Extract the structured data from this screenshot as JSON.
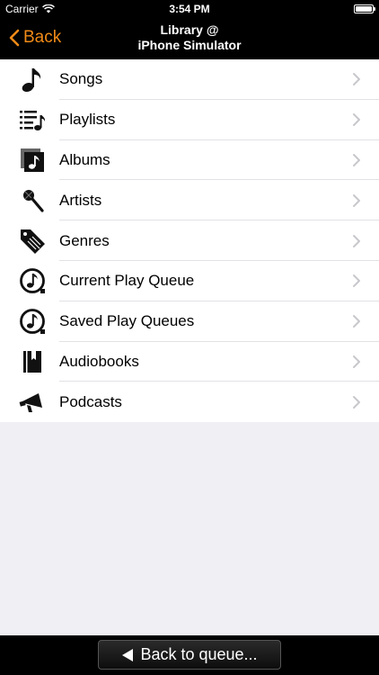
{
  "status_bar": {
    "carrier": "Carrier",
    "time": "3:54 PM",
    "wifi_icon": "wifi-icon",
    "battery_icon": "battery-icon"
  },
  "nav_bar": {
    "back_label": "Back",
    "title_line1": "Library @",
    "title_line2": "iPhone Simulator",
    "accent_color": "#f08a18"
  },
  "menu": {
    "items": [
      {
        "label": "Songs",
        "icon": "music-note-icon"
      },
      {
        "label": "Playlists",
        "icon": "playlist-icon"
      },
      {
        "label": "Albums",
        "icon": "album-icon"
      },
      {
        "label": "Artists",
        "icon": "microphone-icon"
      },
      {
        "label": "Genres",
        "icon": "tag-icon"
      },
      {
        "label": "Current Play Queue",
        "icon": "queue-icon"
      },
      {
        "label": "Saved Play Queues",
        "icon": "saved-queue-icon"
      },
      {
        "label": "Audiobooks",
        "icon": "book-icon"
      },
      {
        "label": "Podcasts",
        "icon": "megaphone-icon"
      }
    ]
  },
  "bottom_bar": {
    "queue_button_label": "Back to queue..."
  }
}
